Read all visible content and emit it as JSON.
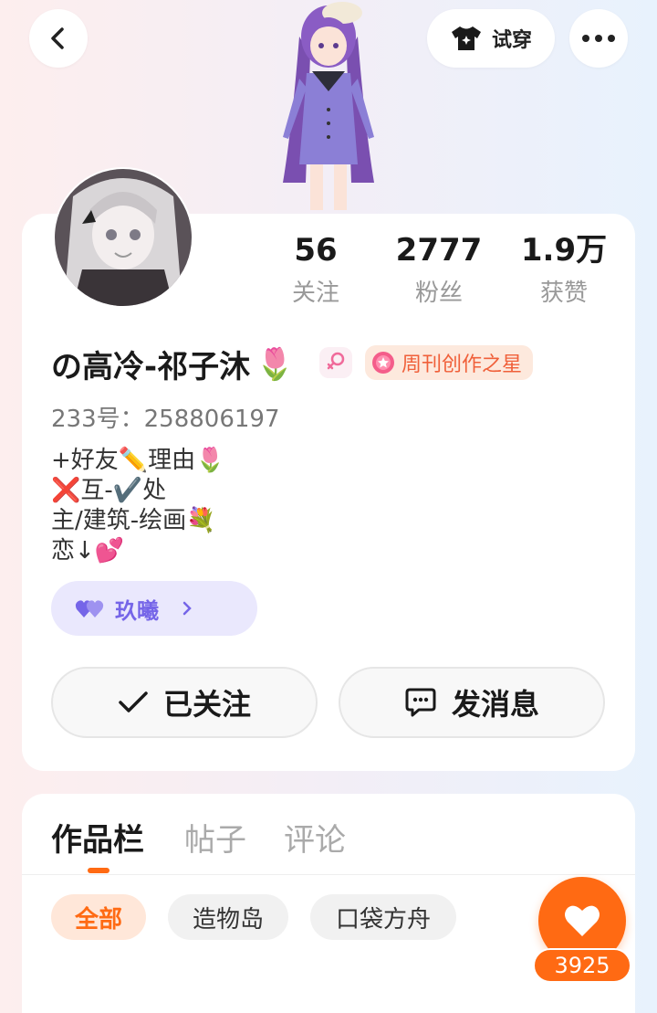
{
  "header": {
    "tryon_label": "试穿"
  },
  "stats": [
    {
      "value": "56",
      "label": "关注"
    },
    {
      "value": "2777",
      "label": "粉丝"
    },
    {
      "value": "1.9万",
      "label": "获赞"
    }
  ],
  "profile": {
    "nickname": "の高冷-祁子沐",
    "nickname_emoji": "🌷",
    "badge": "周刊创作之星",
    "uid": "233号：258806197",
    "bio": "+好友✏️理由🌷\n❌互-✔️处\n主/建筑-绘画💐\n恋↓💕",
    "guild": "玖曦"
  },
  "actions": {
    "follow_label": "已关注",
    "message_label": "发消息"
  },
  "tabs": [
    "作品栏",
    "帖子",
    "评论"
  ],
  "filters": [
    "全部",
    "造物岛",
    "口袋方舟"
  ],
  "like_count": "3925",
  "colors": {
    "accent": "#ff6a13",
    "guild": "#7565e8",
    "badge": "#f0603a"
  }
}
